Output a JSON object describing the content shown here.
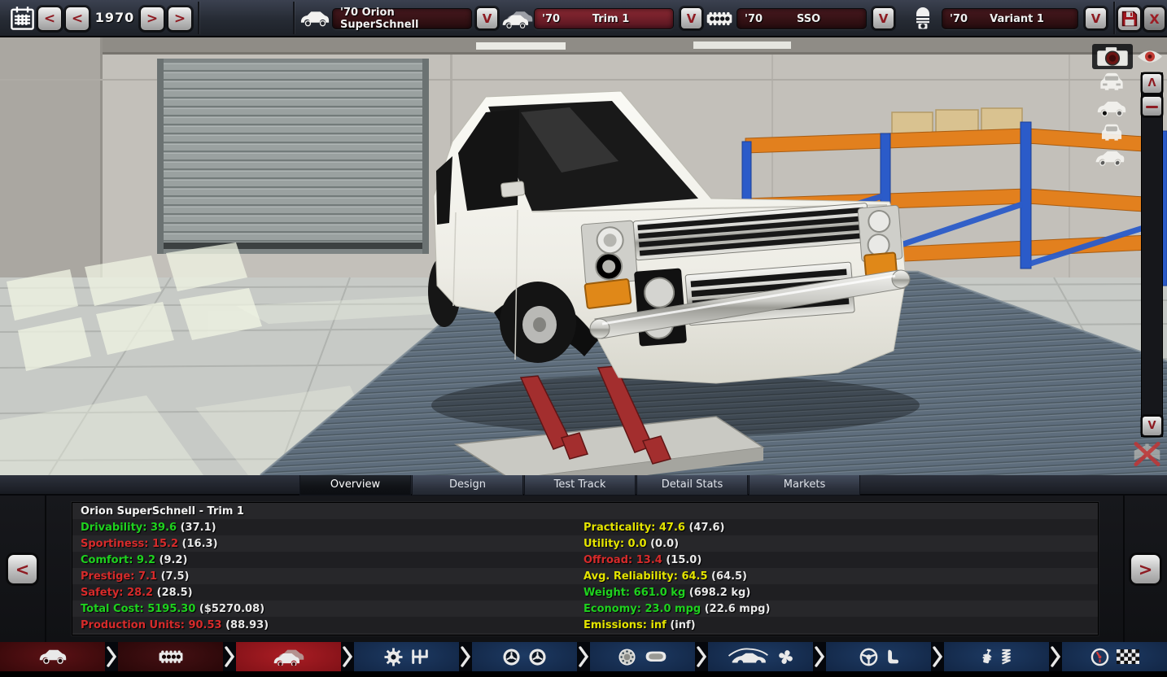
{
  "topbar": {
    "year": "1970",
    "nav": {
      "prev2": "<",
      "prev": "<",
      "next": ">",
      "next2": ">"
    },
    "model": {
      "text": "'70 Orion SuperSchnell",
      "dropdown_label": "V"
    },
    "trim": {
      "year": "'70",
      "name": "Trim 1",
      "dropdown_label": "V"
    },
    "engine": {
      "year": "'70",
      "name": "SSO",
      "dropdown_label": "V"
    },
    "variant": {
      "year": "'70",
      "name": "Variant 1",
      "dropdown_label": "V"
    },
    "close_label": "X"
  },
  "scrollbar": {
    "up_label": "Λ",
    "down_label": "V"
  },
  "tabs": [
    {
      "label": "Overview",
      "active": true
    },
    {
      "label": "Design",
      "active": false
    },
    {
      "label": "Test Track",
      "active": false
    },
    {
      "label": "Detail Stats",
      "active": false
    },
    {
      "label": "Markets",
      "active": false
    }
  ],
  "overview": {
    "title": "Orion SuperSchnell - Trim 1",
    "prev_label": "<",
    "next_label": ">",
    "left_stats": [
      {
        "label": "Drivability",
        "value": "39.6",
        "paren": "(37.1)",
        "color": "green"
      },
      {
        "label": "Sportiness",
        "value": "15.2",
        "paren": "(16.3)",
        "color": "red"
      },
      {
        "label": "Comfort",
        "value": "9.2",
        "paren": "(9.2)",
        "color": "green"
      },
      {
        "label": "Prestige",
        "value": "7.1",
        "paren": "(7.5)",
        "color": "red"
      },
      {
        "label": "Safety",
        "value": "28.2",
        "paren": "(28.5)",
        "color": "red"
      },
      {
        "label": "Total Cost",
        "value": "5195.30",
        "paren": "($5270.08)",
        "color": "green"
      },
      {
        "label": "Production Units",
        "value": "90.53",
        "paren": "(88.93)",
        "color": "red"
      }
    ],
    "right_stats": [
      {
        "label": "Practicality",
        "value": "47.6",
        "paren": "(47.6)",
        "color": "yellow"
      },
      {
        "label": "Utility",
        "value": "0.0",
        "paren": "(0.0)",
        "color": "yellow"
      },
      {
        "label": "Offroad",
        "value": "13.4",
        "paren": "(15.0)",
        "color": "red"
      },
      {
        "label": "Avg. Reliability",
        "value": "64.5",
        "paren": "(64.5)",
        "color": "yellow"
      },
      {
        "label": "Weight",
        "value": "661.0 kg",
        "paren": "(698.2 kg)",
        "color": "green"
      },
      {
        "label": "Economy",
        "value": "23.0 mpg",
        "paren": "(22.6 mpg)",
        "color": "green"
      },
      {
        "label": "Emissions",
        "value": "inf",
        "paren": "(inf)",
        "color": "yellow"
      }
    ]
  },
  "colors": {
    "green": "#1fd11f",
    "red": "#d62b2b",
    "yellow": "#e4e400",
    "paren": "#e9e9e9"
  },
  "toolbar": {
    "segments": [
      {
        "name": "body",
        "style": "red",
        "icons": [
          "car-body-icon"
        ]
      },
      {
        "name": "engine",
        "style": "red-dark",
        "icons": [
          "engine-block-icon"
        ]
      },
      {
        "name": "trim",
        "style": "red-active",
        "icons": [
          "trim-car-icon"
        ]
      },
      {
        "name": "drivetrain",
        "style": "navy",
        "icons": [
          "gear-icon",
          "gearbox-icon"
        ]
      },
      {
        "name": "wheels",
        "style": "navy",
        "icons": [
          "wheel-icon",
          "wheel-icon"
        ]
      },
      {
        "name": "brakes",
        "style": "navy",
        "icons": [
          "brake-disc-icon",
          "brake-pad-icon"
        ]
      },
      {
        "name": "aero-cooling",
        "style": "navy",
        "icons": [
          "aero-car-icon",
          "fan-icon"
        ]
      },
      {
        "name": "interior",
        "style": "navy",
        "icons": [
          "steering-wheel-icon",
          "seat-icon"
        ]
      },
      {
        "name": "suspension",
        "style": "navy",
        "icons": [
          "shock-absorber-icon",
          "spring-icon"
        ]
      },
      {
        "name": "testing",
        "style": "navy",
        "icons": [
          "gauge-icon",
          "checkered-flag-icon"
        ]
      }
    ]
  },
  "view_controls": {
    "views": [
      "car-front-view-icon",
      "car-side-view-icon",
      "car-rear-view-icon",
      "car-threequarter-view-icon"
    ]
  }
}
